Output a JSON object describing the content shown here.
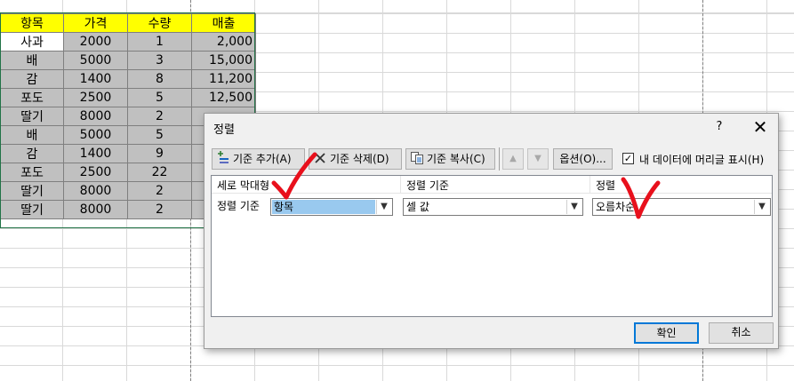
{
  "sheet": {
    "headers": [
      "항목",
      "가격",
      "수량",
      "매출"
    ],
    "rows": [
      [
        "사과",
        "2000",
        "1",
        "2,000"
      ],
      [
        "배",
        "5000",
        "3",
        "15,000"
      ],
      [
        "감",
        "1400",
        "8",
        "11,200"
      ],
      [
        "포도",
        "2500",
        "5",
        "12,500"
      ],
      [
        "딸기",
        "8000",
        "2",
        ""
      ],
      [
        "배",
        "5000",
        "5",
        ""
      ],
      [
        "감",
        "1400",
        "9",
        ""
      ],
      [
        "포도",
        "2500",
        "22",
        ""
      ],
      [
        "딸기",
        "8000",
        "2",
        ""
      ],
      [
        "딸기",
        "8000",
        "2",
        ""
      ]
    ],
    "header_color": "#ffff00",
    "selection_color": "#c0c0c0"
  },
  "dialog": {
    "title": "정렬",
    "help": "?",
    "close": "✕",
    "toolbar": {
      "add_label": "기준 추가(A)",
      "delete_label": "기준 삭제(D)",
      "copy_label": "기준 복사(C)",
      "up_icon": "▲",
      "down_icon": "▼",
      "options_label": "옵션(O)...",
      "has_headers_label": "내 데이터에 머리글 표시(H)",
      "has_headers_checked": "✓"
    },
    "columns": {
      "column": "세로 막대형",
      "sort_on": "정렬 기준",
      "order": "정렬"
    },
    "level": {
      "label": "정렬 기준",
      "column_value": "항목",
      "sort_on_value": "셀 값",
      "order_value": "오름차순"
    },
    "ok_label": "확인",
    "cancel_label": "취소"
  },
  "accent_color": "#0078d7",
  "annotation_color": "#e8101c"
}
